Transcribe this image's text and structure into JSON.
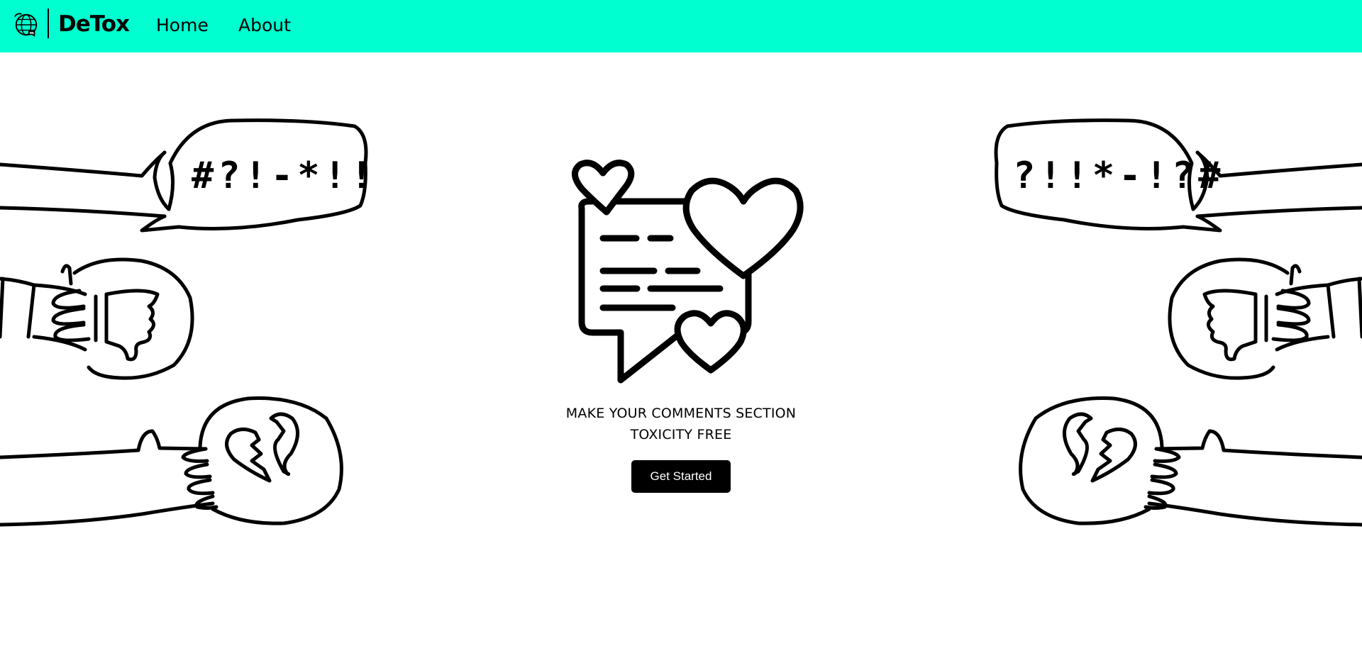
{
  "colors": {
    "navbar_bg": "#00ffd0",
    "text": "#000000",
    "button_bg": "#000000",
    "button_text": "#ffffff",
    "page_bg": "#ffffff"
  },
  "navbar": {
    "logo_icon": "globe-chat-icon",
    "brand": "DeTox",
    "links": [
      {
        "label": "Home"
      },
      {
        "label": "About"
      }
    ]
  },
  "hero": {
    "icon": "chat-hearts-icon",
    "tagline_line1": "MAKE YOUR COMMENTS SECTION",
    "tagline_line2": "TOXICITY FREE",
    "cta_label": "Get Started"
  },
  "illustrations": {
    "left": {
      "speech_bubble_text": "#?!-*!!?",
      "items": [
        "speech-bubble-hand",
        "thumbs-down-hand",
        "broken-heart-hand"
      ]
    },
    "right": {
      "speech_bubble_text": "?!!*-!?#",
      "items": [
        "speech-bubble-hand",
        "thumbs-down-hand",
        "broken-heart-hand"
      ]
    }
  }
}
